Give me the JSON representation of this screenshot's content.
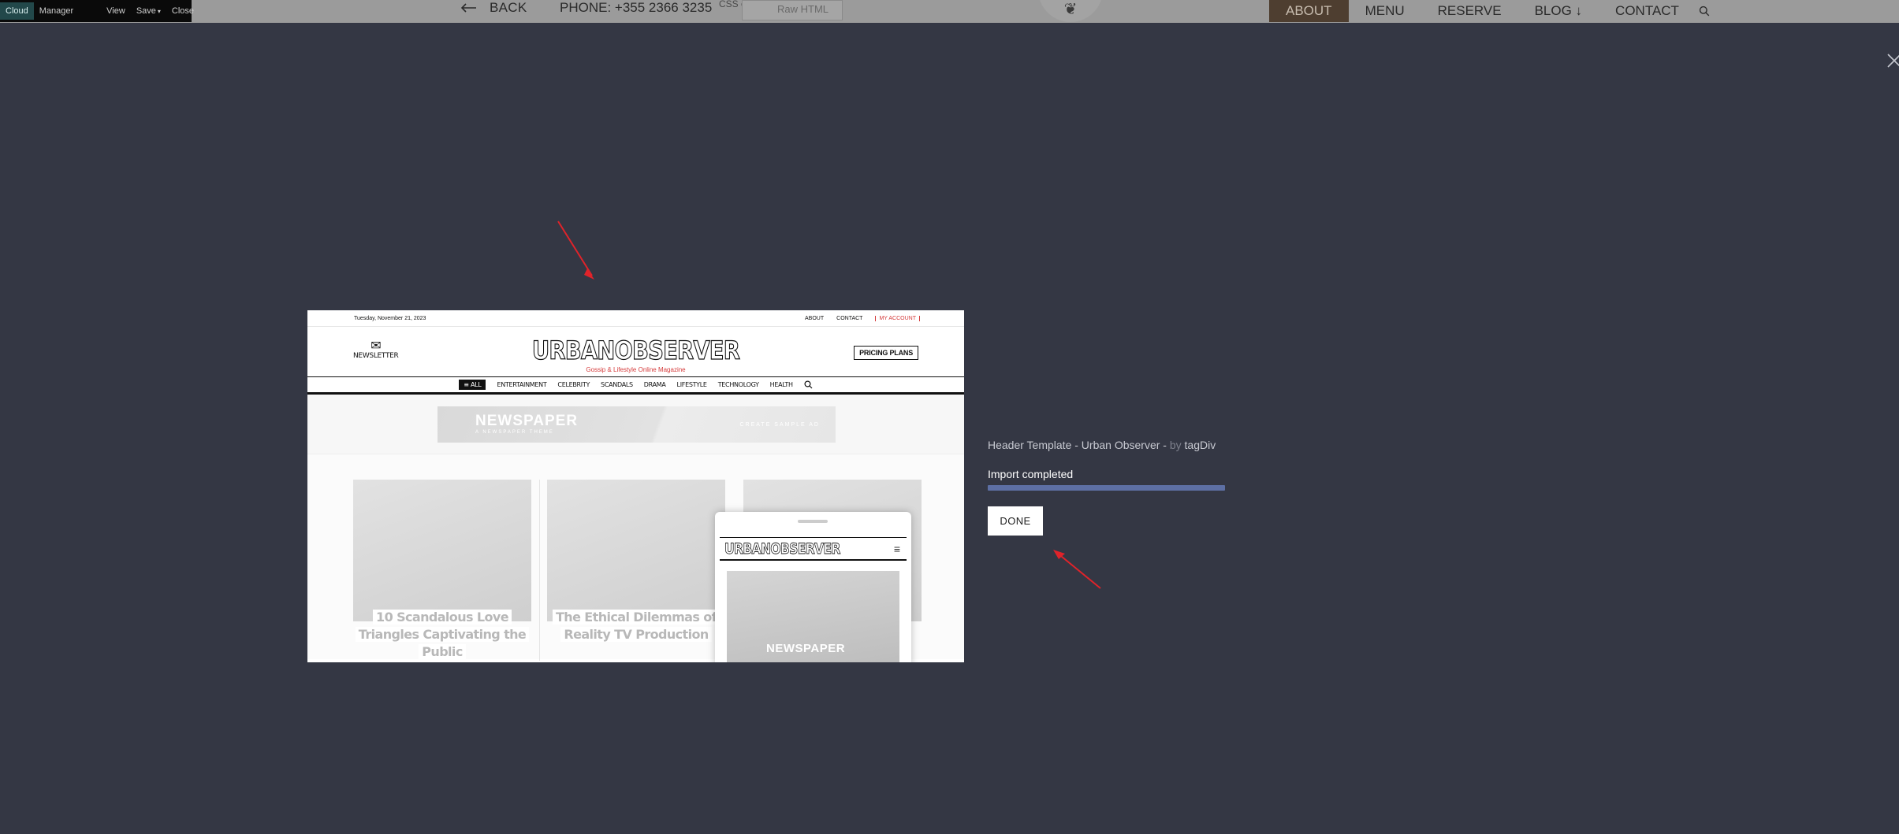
{
  "colors": {
    "overlay_bg": "#343744",
    "accent_progress": "#5d6fa4",
    "arrow_red": "#e0232a",
    "nav_active_bg": "#4e3e30"
  },
  "toolbar": {
    "items": [
      "Cloud",
      "Manager",
      "View",
      "Save",
      "Close"
    ],
    "save_caret": "▾"
  },
  "page_header": {
    "back_label": "BACK",
    "back_icon": "arrow-left-icon",
    "phone": "PHONE: +355 2366 3235",
    "css_code_label": "CSS code",
    "raw_html_label": "Raw HTML",
    "nav": [
      "ABOUT",
      "MENU",
      "RESERVE",
      "BLOG ↓",
      "CONTACT"
    ],
    "search_icon": "search-icon"
  },
  "modal": {
    "close_icon": "close-icon",
    "template_name": "Header Template - Urban Observer - ",
    "by_label": "by",
    "author": " tagDiv",
    "status": "Import completed",
    "progress": 1.0,
    "done_label": "DONE"
  },
  "preview": {
    "date": "Tuesday, November 21, 2023",
    "top_links": [
      "ABOUT",
      "CONTACT"
    ],
    "my_account": "MY ACCOUNT",
    "newsletter": "NEWSLETTER",
    "logo": "URBANOBSERVER",
    "tagline": "Gossip & Lifestyle Online Magazine",
    "pricing": "PRICING PLANS",
    "menu_all": "≡ ALL",
    "menu": [
      "ENTERTAINMENT",
      "CELEBRITY",
      "SCANDALS",
      "DRAMA",
      "LIFESTYLE",
      "TECHNOLOGY",
      "HEALTH"
    ],
    "ad_title": "NEWSPAPER",
    "ad_sub": "A NEWSPAPER THEME",
    "ad_right": "CREATE SAMPLE AD",
    "card1_title": "10 Scandalous Love Triangles Captivating the Public",
    "card2_title": "The Ethical Dilemmas of Reality TV Production",
    "mobile_logo": "URBANOBSERVER",
    "mobile_img_text": "NEWSPAPER"
  }
}
